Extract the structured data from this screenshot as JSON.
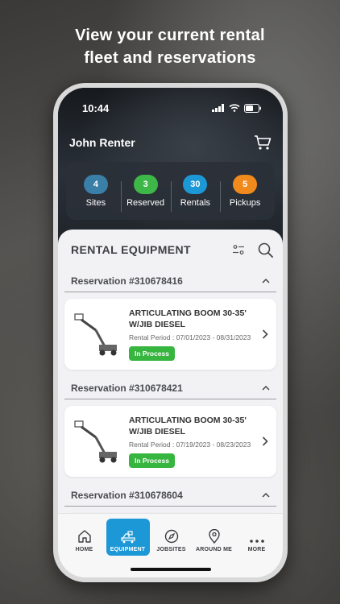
{
  "headline": {
    "line1": "View your current rental",
    "line2": "fleet and reservations"
  },
  "status_bar": {
    "time": "10:44"
  },
  "user": {
    "name": "John Renter"
  },
  "stats": [
    {
      "count": "4",
      "label": "Sites",
      "color": "#3a7fa8"
    },
    {
      "count": "3",
      "label": "Reserved",
      "color": "#3db848"
    },
    {
      "count": "30",
      "label": "Rentals",
      "color": "#1d98d6"
    },
    {
      "count": "5",
      "label": "Pickups",
      "color": "#f08a1d"
    }
  ],
  "section": {
    "title": "RENTAL EQUIPMENT"
  },
  "reservations": [
    {
      "title": "Reservation #310678416",
      "item_name": "ARTICULATING BOOM 30-35' W/JIB DIESEL",
      "period": "Rental Period : 07/01/2023 - 08/31/2023",
      "status": "In Process"
    },
    {
      "title": "Reservation #310678421",
      "item_name": "ARTICULATING BOOM 30-35' W/JIB DIESEL",
      "period": "Rental Period : 07/19/2023 - 08/23/2023",
      "status": "In Process"
    },
    {
      "title": "Reservation #310678604"
    }
  ],
  "tabs": [
    {
      "label": "HOME",
      "icon": "home-icon"
    },
    {
      "label": "EQUIPMENT",
      "icon": "equipment-icon",
      "active": true
    },
    {
      "label": "JOBSITES",
      "icon": "compass-icon"
    },
    {
      "label": "AROUND ME",
      "icon": "location-pin-icon"
    },
    {
      "label": "MORE",
      "icon": "more-dots-icon"
    }
  ],
  "colors": {
    "accent": "#1d98d6",
    "status_green": "#36b53f"
  }
}
